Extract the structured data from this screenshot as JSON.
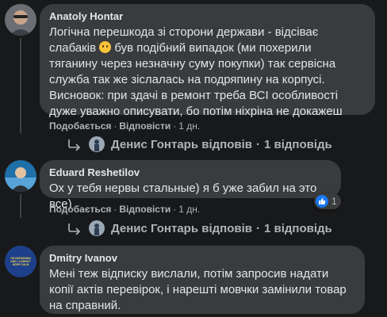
{
  "comments": [
    {
      "author": "Anatoly Hontar",
      "text_before_emoji": "Логічна перешкода зі сторони держави - відсіває\nслабаків ",
      "emoji": "slightly-smiling-face",
      "text_after_emoji": " був подібний випадок (ми похерили\nтяганину через незначну суму покупки) так сервісна\nслужба так же зіслалась на подряпину на корпусі.\nВисновок: при здачі в ремонт треба ВСІ особливості\nдуже уважно описувати, бо потім ніхріна не докажеш",
      "like_label": "Подобається",
      "reply_label": "Відповісти",
      "time": "1 дн.",
      "replies": {
        "author": "Денис Гонтарь",
        "verb": "відповів",
        "count": "1 відповідь"
      }
    },
    {
      "author": "Eduard Reshetilov",
      "text": "Ох у тебя нервы стальные) я б уже забил на это все)",
      "reaction_count": "1",
      "like_label": "Подобається",
      "reply_label": "Відповісти",
      "time": "1 дн.",
      "replies": {
        "author": "Денис Гонтарь",
        "verb": "відповів",
        "count": "1 відповідь"
      }
    },
    {
      "author": "Dmitry Ivanov",
      "text": "Мені теж відписку вислали, потім запросив надати\nкопії актів перевірок, і нарешті мовчки замінили товар\nна справний.",
      "avatar_text": "I'M UKRAINIAN AND I CANNOT KEEP CALM"
    }
  ],
  "colors": {
    "background": "#18191a",
    "bubble": "#3a3b3c",
    "text": "#e4e6eb",
    "secondary": "#b0b3b8",
    "like_blue": "#1877f2"
  }
}
